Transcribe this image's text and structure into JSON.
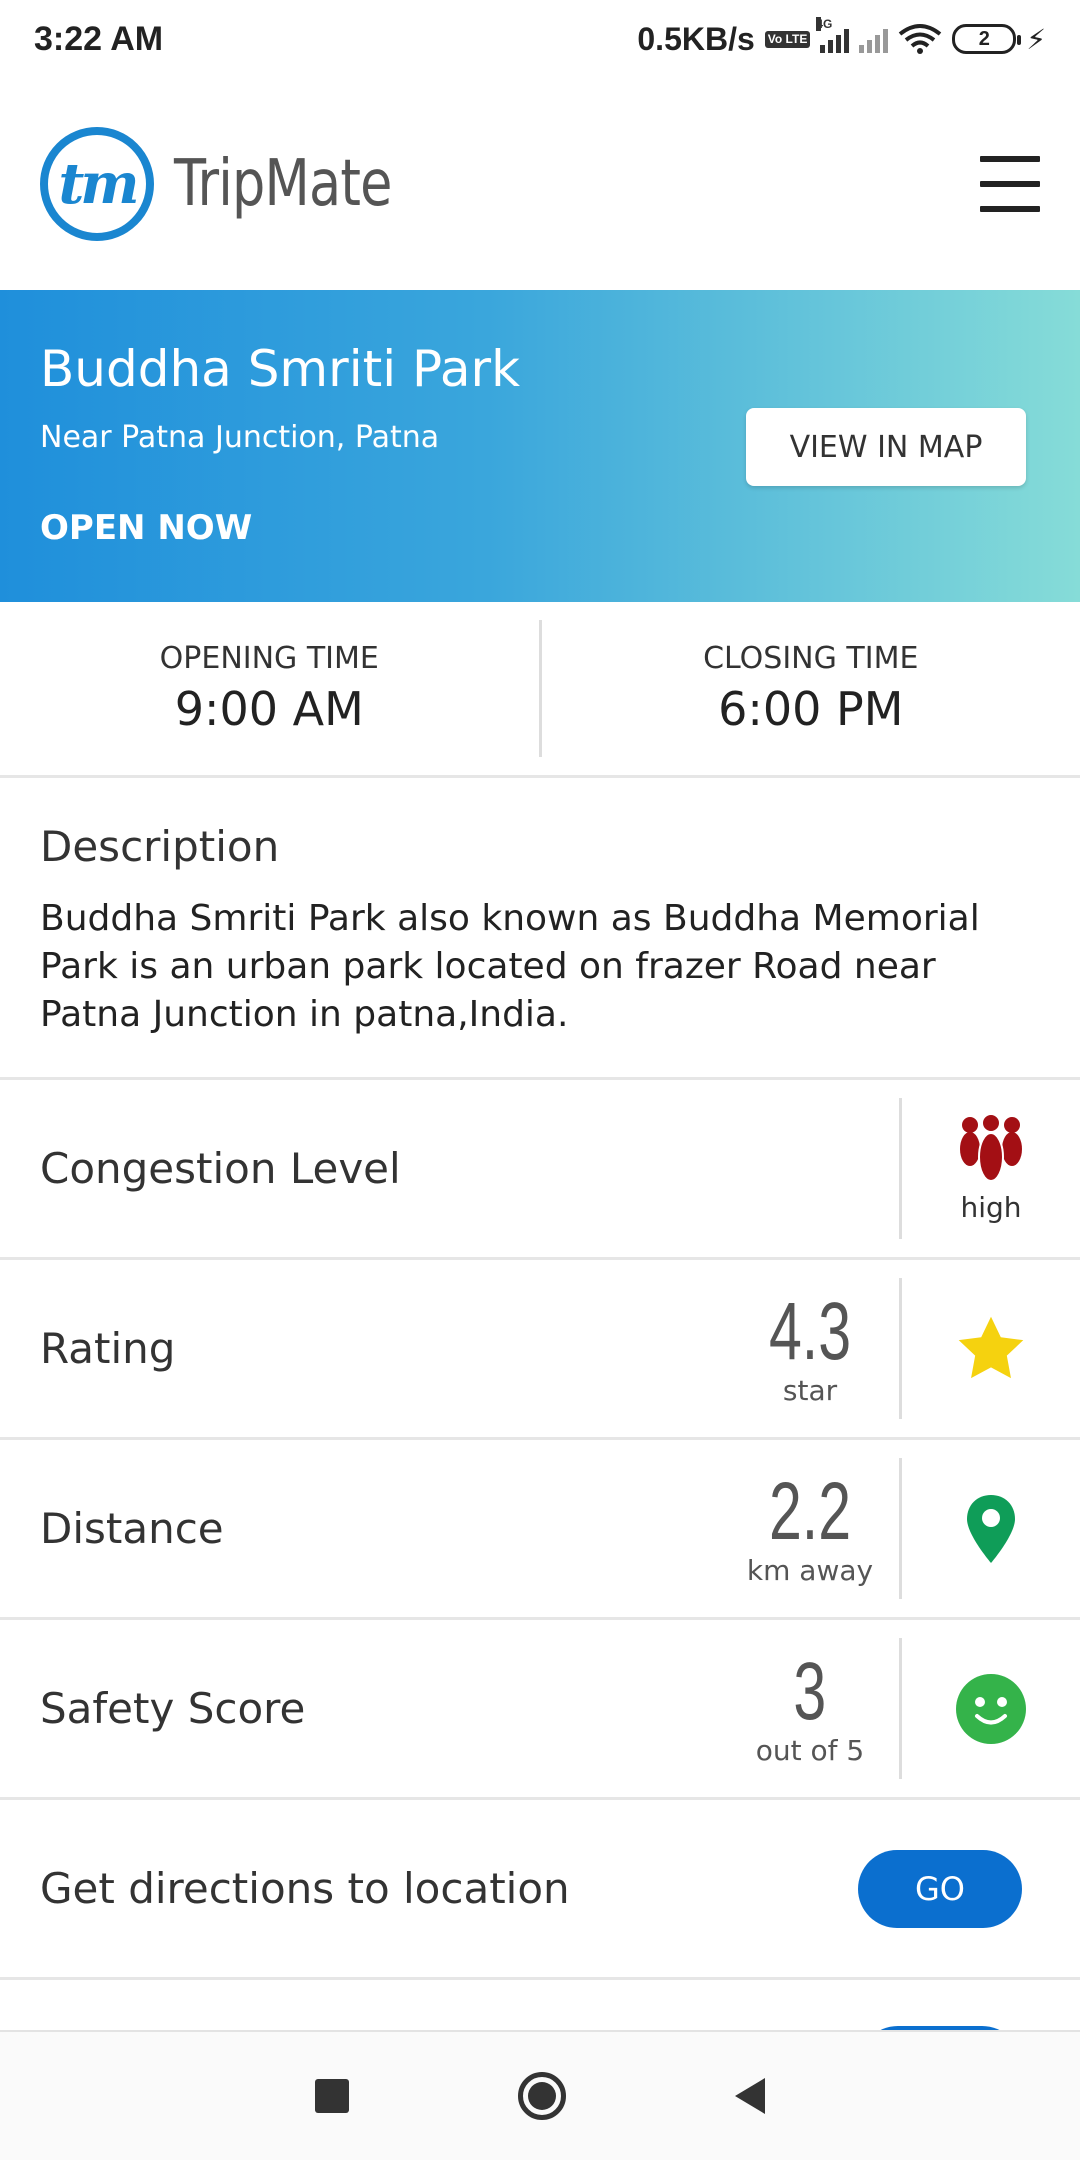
{
  "status_bar": {
    "time": "3:22 AM",
    "net_speed": "0.5KB/s",
    "volte": "Vo LTE",
    "network_type": "4G",
    "battery_level": "2"
  },
  "header": {
    "logo_text": "tm",
    "app_name": "TripMate"
  },
  "place": {
    "name": "Buddha Smriti Park",
    "address": "Near Patna Junction, Patna",
    "status": "OPEN NOW",
    "map_button": "VIEW IN MAP"
  },
  "timings": {
    "opening_label": "OPENING TIME",
    "opening_value": "9:00 AM",
    "closing_label": "CLOSING TIME",
    "closing_value": "6:00 PM"
  },
  "description": {
    "title": "Description",
    "body": "Buddha Smriti Park also known as Buddha Memorial Park is an urban park located on frazer Road near Patna Junction in patna,India."
  },
  "congestion": {
    "label": "Congestion Level",
    "value": "high",
    "icon": "crowd-icon",
    "color": "#a30f14"
  },
  "rating": {
    "label": "Rating",
    "value": "4.3",
    "unit": "star",
    "icon": "star-icon",
    "color": "#f5d20f"
  },
  "distance": {
    "label": "Distance",
    "value": "2.2",
    "unit": "km away",
    "icon": "map-pin-icon",
    "color": "#0f9d58"
  },
  "safety": {
    "label": "Safety Score",
    "value": "3",
    "unit": "out of 5",
    "icon": "smiley-icon",
    "color": "#34b34a"
  },
  "directions": {
    "label": "Get directions to location",
    "button": "GO"
  },
  "colors": {
    "primary": "#0b6fcf",
    "hero_gradient_start": "#1f8fdb",
    "hero_gradient_end": "#86dcd8"
  }
}
